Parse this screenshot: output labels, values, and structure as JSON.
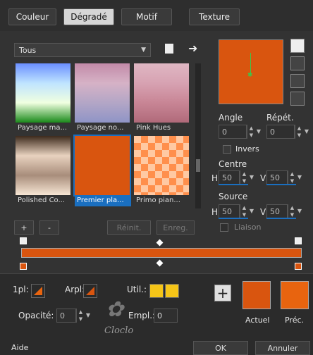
{
  "tabs": [
    "Couleur",
    "Dégradé",
    "Motif",
    "Texture"
  ],
  "category_dropdown": {
    "value": "Tous"
  },
  "gradients": [
    {
      "name": "Paysage ma...",
      "colors": [
        "#6b8fff",
        "#bfe4ff",
        "#f0ffe0",
        "#1a8a1a"
      ]
    },
    {
      "name": "Paysage no...",
      "colors": [
        "#c28aa8",
        "#d6b2c6",
        "#b3a6c6",
        "#8f94c6"
      ]
    },
    {
      "name": "Pink Hues",
      "colors": [
        "#dfb7c3",
        "#d7a2b2",
        "#c88595",
        "#b06a7a"
      ]
    },
    {
      "name": "Polished Co...",
      "colors": [
        "#3d2a1c",
        "#e8d2bf",
        "#a88d7b",
        "#f7e6d4"
      ]
    },
    {
      "name": "Premier pla...",
      "colors": [
        "#d9550f",
        "#d9550f"
      ]
    },
    {
      "name": "Primo pian...",
      "colors": [
        "#ffcfb0",
        "#ff9858",
        "#ef6a1c"
      ]
    }
  ],
  "preview": {
    "color": "#d9550f"
  },
  "angle": {
    "label": "Angle",
    "value": "0"
  },
  "repeat": {
    "label": "Répét.",
    "value": "0"
  },
  "invert": {
    "label": "Invers"
  },
  "center": {
    "label": "Centre",
    "h_label": "H",
    "h_value": "50",
    "v_label": "V",
    "v_value": "50"
  },
  "source": {
    "label": "Source",
    "h_label": "H",
    "h_value": "50",
    "v_label": "V",
    "v_value": "50"
  },
  "link": {
    "label": "Liaison"
  },
  "list_buttons": {
    "add": "+",
    "remove": "-",
    "reset": "Réinit.",
    "save": "Enreg."
  },
  "gradient_bar": {
    "color": "#d9550f"
  },
  "bottom": {
    "fg_label": "1pl:",
    "bg_label": "Arpl:",
    "user_label": "Util.:",
    "user_color": "#f5c518",
    "opacity_label": "Opacité:",
    "opacity_value": "0",
    "position_label": "Empl.:",
    "position_value": "0"
  },
  "current": {
    "label": "Actuel",
    "color": "#d9550f"
  },
  "previous": {
    "label": "Préc.",
    "color": "#e8640f"
  },
  "footer": {
    "help": "Aide",
    "ok": "OK",
    "cancel": "Annuler"
  },
  "watermark": "Cloclo"
}
